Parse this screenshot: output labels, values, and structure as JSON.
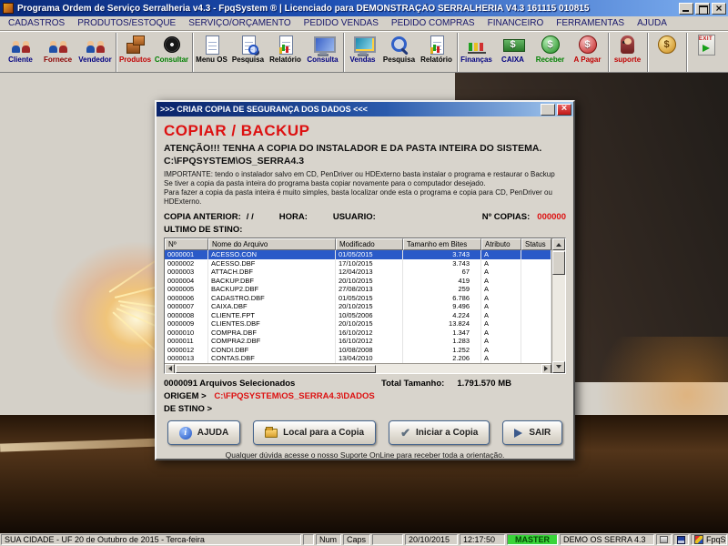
{
  "window": {
    "title": "Programa Ordem de Serviço Serralheria v4.3 - FpqSystem ® | Licenciado para  DEMONSTRAÇÃO SERRALHERIA V4.3 161115 010815"
  },
  "menu": {
    "items": [
      {
        "label": "CADASTROS"
      },
      {
        "label": "PRODUTOS/ESTOQUE"
      },
      {
        "label": "SERVIÇO/ORÇAMENTO"
      },
      {
        "label": "PEDIDO VENDAS"
      },
      {
        "label": "PEDIDO COMPRAS"
      },
      {
        "label": "FINANCEIRO"
      },
      {
        "label": "FERRAMENTAS"
      },
      {
        "label": "AJUDA"
      }
    ]
  },
  "toolbar": {
    "items": [
      {
        "label": "Cliente",
        "icon": "people",
        "label_color": "#000080"
      },
      {
        "label": "Fornece",
        "icon": "people",
        "label_color": "#8b0000"
      },
      {
        "label": "Vendedor",
        "icon": "people",
        "label_color": "#000080"
      },
      {
        "label": "Produtos",
        "icon": "boxes",
        "label_color": "#c00000",
        "state": "group-start"
      },
      {
        "label": "Consultar",
        "icon": "disc",
        "label_color": "#008000"
      },
      {
        "label": "Menu OS",
        "icon": "document",
        "label_color": "#000000",
        "state": "group-start"
      },
      {
        "label": "Pesquisa",
        "icon": "search-document",
        "label_color": "#000000"
      },
      {
        "label": "Relatório",
        "icon": "report",
        "label_color": "#000000"
      },
      {
        "label": "Consulta",
        "icon": "monitor",
        "label_color": "#000080"
      },
      {
        "label": "Vendas",
        "icon": "sales-monitor",
        "label_color": "#000080",
        "state": "group-start"
      },
      {
        "label": "Pesquisa",
        "icon": "search",
        "label_color": "#000000"
      },
      {
        "label": "Relatório",
        "icon": "report",
        "label_color": "#000000"
      },
      {
        "label": "Finanças",
        "icon": "finance-chart",
        "label_color": "#000080",
        "state": "group-start"
      },
      {
        "label": "CAIXA",
        "icon": "cash",
        "label_color": "#000080",
        "icon_text": "$"
      },
      {
        "label": "Receber",
        "icon": "dollar-green",
        "label_color": "#008000",
        "icon_text": "$"
      },
      {
        "label": "A Pagar",
        "icon": "dollar-red",
        "label_color": "#c00000",
        "icon_text": "$"
      },
      {
        "label": "suporte",
        "icon": "support",
        "label_color": "#c00000",
        "state": "group-start"
      },
      {
        "label": "",
        "icon": "coin",
        "icon_text": "$",
        "state": "group-start"
      },
      {
        "label": "",
        "icon": "exit-door",
        "icon_text": "EXIT",
        "state": "group-start"
      }
    ]
  },
  "dialog": {
    "title": ">>> CRIAR COPIA DE SEGURANÇA DOS DADOS <<<",
    "heading": "COPIAR / BACKUP",
    "warning": "ATENÇÃO!!!  TENHA A COPIA DO INSTALADOR E DA PASTA INTEIRA DO  SISTEMA.",
    "system_path": "C:\\FPQSYSTEM\\OS_SERRA4.3",
    "note1": "IMPORTANTE: tendo o instalador salvo em CD, PenDriver ou HDExterno basta instalar o programa e restaurar o Backup",
    "note2": "Se tiver a copia da pasta inteira do programa basta copiar novamente para o computador desejado.",
    "note3": "Para fazer a copia da pasta inteira é muito simples, basta localizar onde esta o programa e copia para CD, PenDriver ou HDExterno.",
    "copia_anterior_label": "COPIA ANTERIOR:",
    "copia_anterior_value": "/ /",
    "hora_label": "HORA:",
    "usuario_label": "USUARIO:",
    "num_copias_label": "Nº COPIAS:",
    "num_copias_value": "000000",
    "ultimo_destino_label": "ULTIMO DE STINO:",
    "table": {
      "headers": [
        "Nº",
        "Nome do Arquivo",
        "Modificado",
        "Tamanho em Bites",
        "Atributo",
        "Status"
      ],
      "rows": [
        {
          "num": "0000001",
          "name": "ACESSO.CON",
          "modified": "01/05/2015",
          "size": "3.743",
          "attr": "A",
          "status": "",
          "state": "selected"
        },
        {
          "num": "0000002",
          "name": "ACESSO.DBF",
          "modified": "17/10/2015",
          "size": "3.743",
          "attr": "A",
          "status": ""
        },
        {
          "num": "0000003",
          "name": "ATTACH.DBF",
          "modified": "12/04/2013",
          "size": "67",
          "attr": "A",
          "status": ""
        },
        {
          "num": "0000004",
          "name": "BACKUP.DBF",
          "modified": "20/10/2015",
          "size": "419",
          "attr": "A",
          "status": ""
        },
        {
          "num": "0000005",
          "name": "BACKUP2.DBF",
          "modified": "27/08/2013",
          "size": "259",
          "attr": "A",
          "status": ""
        },
        {
          "num": "0000006",
          "name": "CADASTRO.DBF",
          "modified": "01/05/2015",
          "size": "6.786",
          "attr": "A",
          "status": ""
        },
        {
          "num": "0000007",
          "name": "CAIXA.DBF",
          "modified": "20/10/2015",
          "size": "9.496",
          "attr": "A",
          "status": ""
        },
        {
          "num": "0000008",
          "name": "CLIENTE.FPT",
          "modified": "10/05/2006",
          "size": "4.224",
          "attr": "A",
          "status": ""
        },
        {
          "num": "0000009",
          "name": "CLIENTES.DBF",
          "modified": "20/10/2015",
          "size": "13.824",
          "attr": "A",
          "status": ""
        },
        {
          "num": "0000010",
          "name": "COMPRA.DBF",
          "modified": "16/10/2012",
          "size": "1.347",
          "attr": "A",
          "status": ""
        },
        {
          "num": "0000011",
          "name": "COMPRA2.DBF",
          "modified": "16/10/2012",
          "size": "1.283",
          "attr": "A",
          "status": ""
        },
        {
          "num": "0000012",
          "name": "CONDI.DBF",
          "modified": "10/08/2008",
          "size": "1.252",
          "attr": "A",
          "status": ""
        },
        {
          "num": "0000013",
          "name": "CONTAS.DBF",
          "modified": "13/04/2010",
          "size": "2.206",
          "attr": "A",
          "status": ""
        }
      ]
    },
    "selected_summary": "0000091 Arquivos Selecionados",
    "total_label": "Total Tamanho:",
    "total_value": "1.791.570 MB",
    "origem_label": "ORIGEM >",
    "origem_value": "C:\\FPQSYSTEM\\OS_SERRA4.3\\DADOS",
    "destino_label": "DE STINO >",
    "buttons": {
      "ajuda": "AJUDA",
      "ajuda_icon": "i",
      "local": "Local para a Copia",
      "iniciar": "Iniciar a Copia",
      "iniciar_icon": "✔",
      "sair": "SAIR"
    },
    "footer_note": "Qualquer dúvida acesse o nosso Suporte OnLine para receber toda a orientação."
  },
  "statusbar": {
    "location": "SUA CIDADE - UF 20 de Outubro de 2015 - Terca-feira",
    "num": "Num",
    "caps": "Caps",
    "date": "20/10/2015",
    "time": "12:17:50",
    "user": "MASTER",
    "product": "DEMO OS SERRA 4.3",
    "brand": "FpqSystem"
  }
}
